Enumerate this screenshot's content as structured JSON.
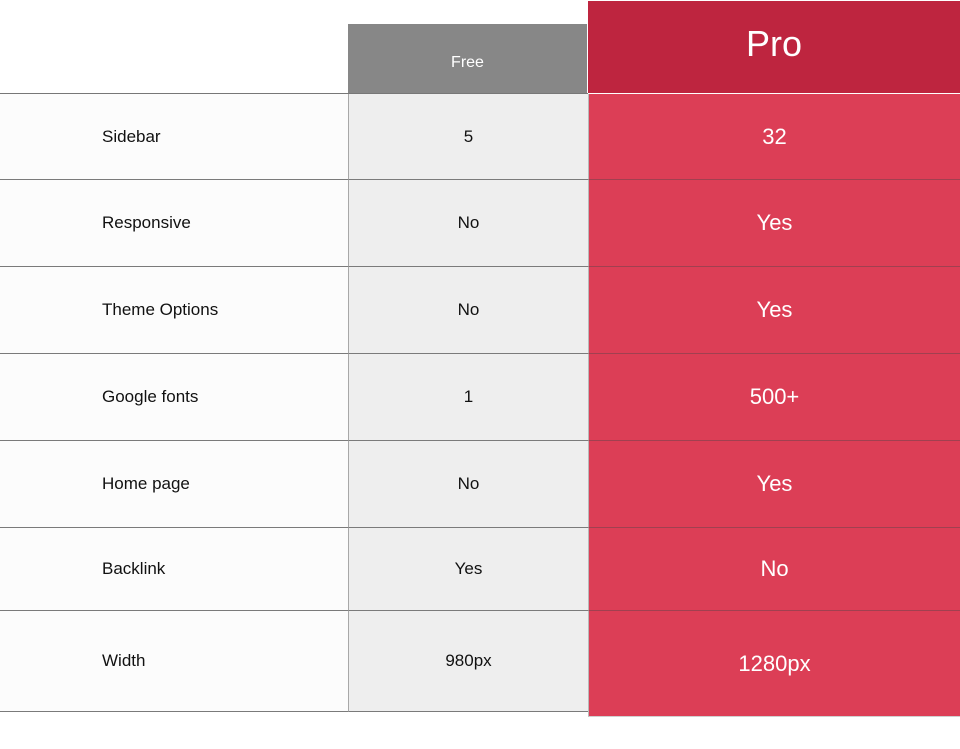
{
  "header": {
    "free_label": "Free",
    "pro_label": "Pro"
  },
  "colors": {
    "free_header": "#878787",
    "pro_header": "#be253f",
    "pro_body": "#dc3e56",
    "free_body": "#eeeeee",
    "feature_body": "#fcfcfc"
  },
  "rows": [
    {
      "feature": "Sidebar",
      "free": "5",
      "pro": "32"
    },
    {
      "feature": "Responsive",
      "free": "No",
      "pro": "Yes"
    },
    {
      "feature": "Theme Options",
      "free": "No",
      "pro": "Yes"
    },
    {
      "feature": "Google fonts",
      "free": "1",
      "pro": "500+"
    },
    {
      "feature": "Home page",
      "free": "No",
      "pro": "Yes"
    },
    {
      "feature": "Backlink",
      "free": "Yes",
      "pro": "No"
    },
    {
      "feature": "Width",
      "free": "980px",
      "pro": "1280px"
    }
  ]
}
